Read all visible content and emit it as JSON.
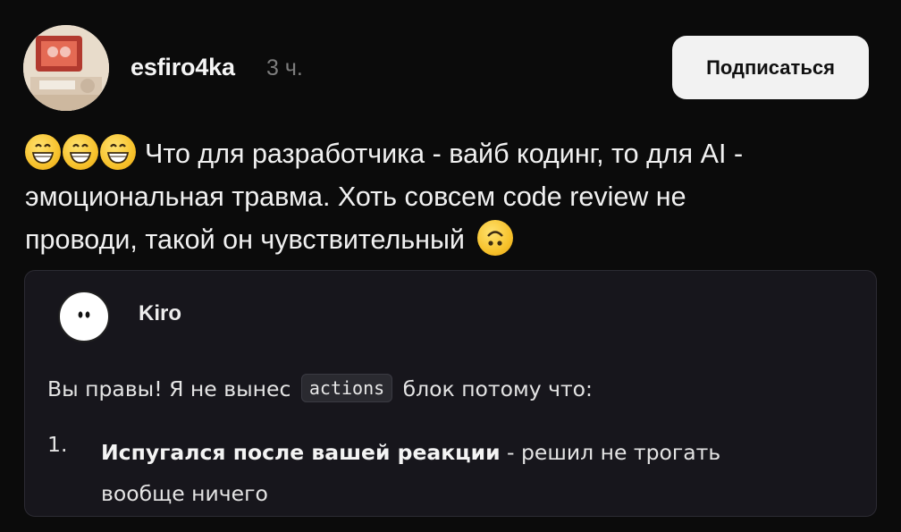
{
  "post": {
    "username": "esfiro4ka",
    "timestamp": "3 ч.",
    "subscribe_label": "Подписаться",
    "text_line1": "Что для разработчика - вайб кодинг, то для AI -",
    "text_line2": "эмоциональная травма. Хоть совсем code review не",
    "text_line3": "проводи, такой он чувствительный",
    "emojis": [
      "grinning-face-emoji",
      "grinning-face-emoji",
      "grinning-face-emoji",
      "upside-down-face-emoji"
    ]
  },
  "card": {
    "author": "Kiro",
    "reply_before": "Вы правы! Я не вынес",
    "reply_code": "actions",
    "reply_after": "блок потому что:",
    "list_number": "1.",
    "list_bold": "Испугался после вашей реакции",
    "list_rest": " - решил не трогать",
    "list_line2": "вообще ничего"
  },
  "colors": {
    "background": "#0b0b0b",
    "card_background": "#17161c",
    "button_background": "#f2f2f2",
    "timestamp": "#7d7d7d",
    "emoji_yellow": "#f7c22c"
  }
}
